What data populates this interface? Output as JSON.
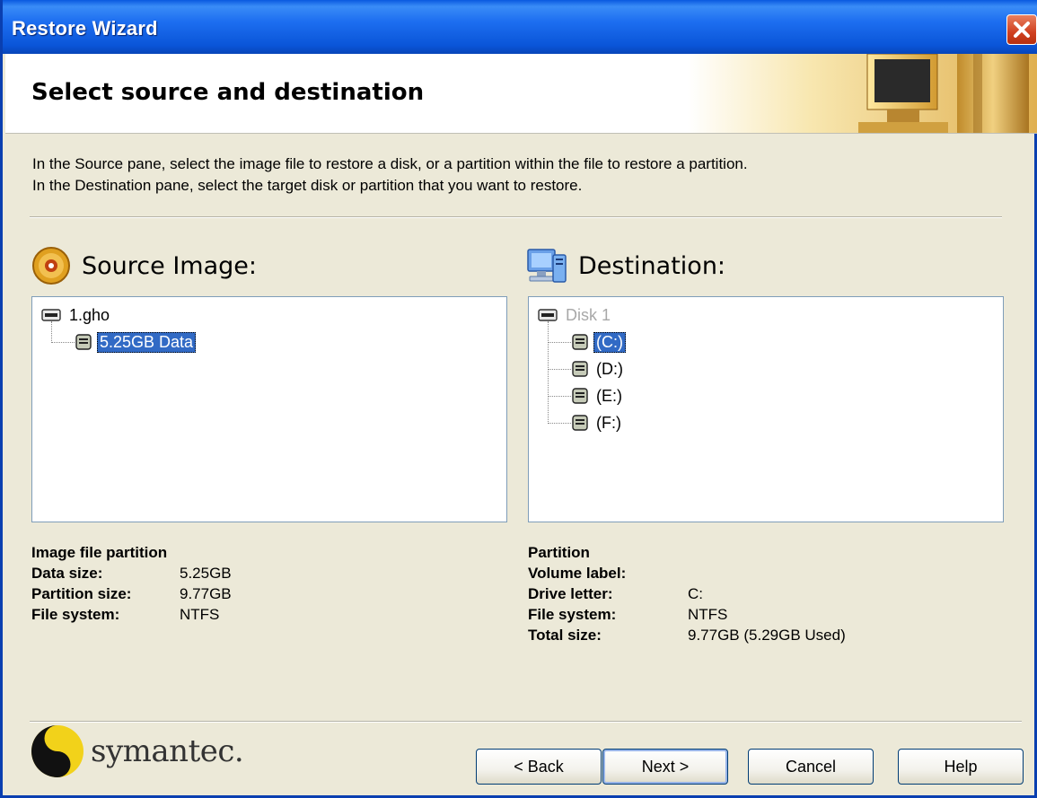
{
  "window": {
    "title": "Restore Wizard"
  },
  "header": {
    "title": "Select source and destination"
  },
  "instructions": {
    "line1": "In the Source pane, select the image file to restore a disk, or a partition within the file to restore a partition.",
    "line2": "In the Destination pane, select the target disk or partition that you want to restore."
  },
  "source": {
    "heading": "Source Image:",
    "tree": {
      "root": "1.gho",
      "children": [
        "5.25GB Data"
      ],
      "selected": "5.25GB Data"
    },
    "info": {
      "title": "Image file partition",
      "rows": [
        {
          "label": "Data size:",
          "value": "5.25GB"
        },
        {
          "label": "Partition size:",
          "value": "9.77GB"
        },
        {
          "label": "File system:",
          "value": "NTFS"
        }
      ]
    }
  },
  "destination": {
    "heading": "Destination:",
    "tree": {
      "root": "Disk 1",
      "children": [
        "(C:)",
        "(D:)",
        "(E:)",
        "(F:)"
      ],
      "selected": "(C:)"
    },
    "info": {
      "title": "Partition",
      "rows": [
        {
          "label": "Volume label:",
          "value": ""
        },
        {
          "label": "Drive letter:",
          "value": "C:"
        },
        {
          "label": "File system:",
          "value": "NTFS"
        },
        {
          "label": "Total size:",
          "value": "9.77GB (5.29GB Used)"
        }
      ]
    }
  },
  "footer": {
    "logo_text": "symantec.",
    "buttons": {
      "back": "< Back",
      "next": "Next >",
      "cancel": "Cancel",
      "help": "Help"
    }
  },
  "icons": {
    "close": "close-icon",
    "source": "disc-icon",
    "destination": "computer-icon",
    "drive": "drive-icon",
    "partition": "partition-icon"
  },
  "colors": {
    "titlebar": "#0a55d8",
    "selection": "#316ac5",
    "dialog_bg": "#ece9d8"
  }
}
